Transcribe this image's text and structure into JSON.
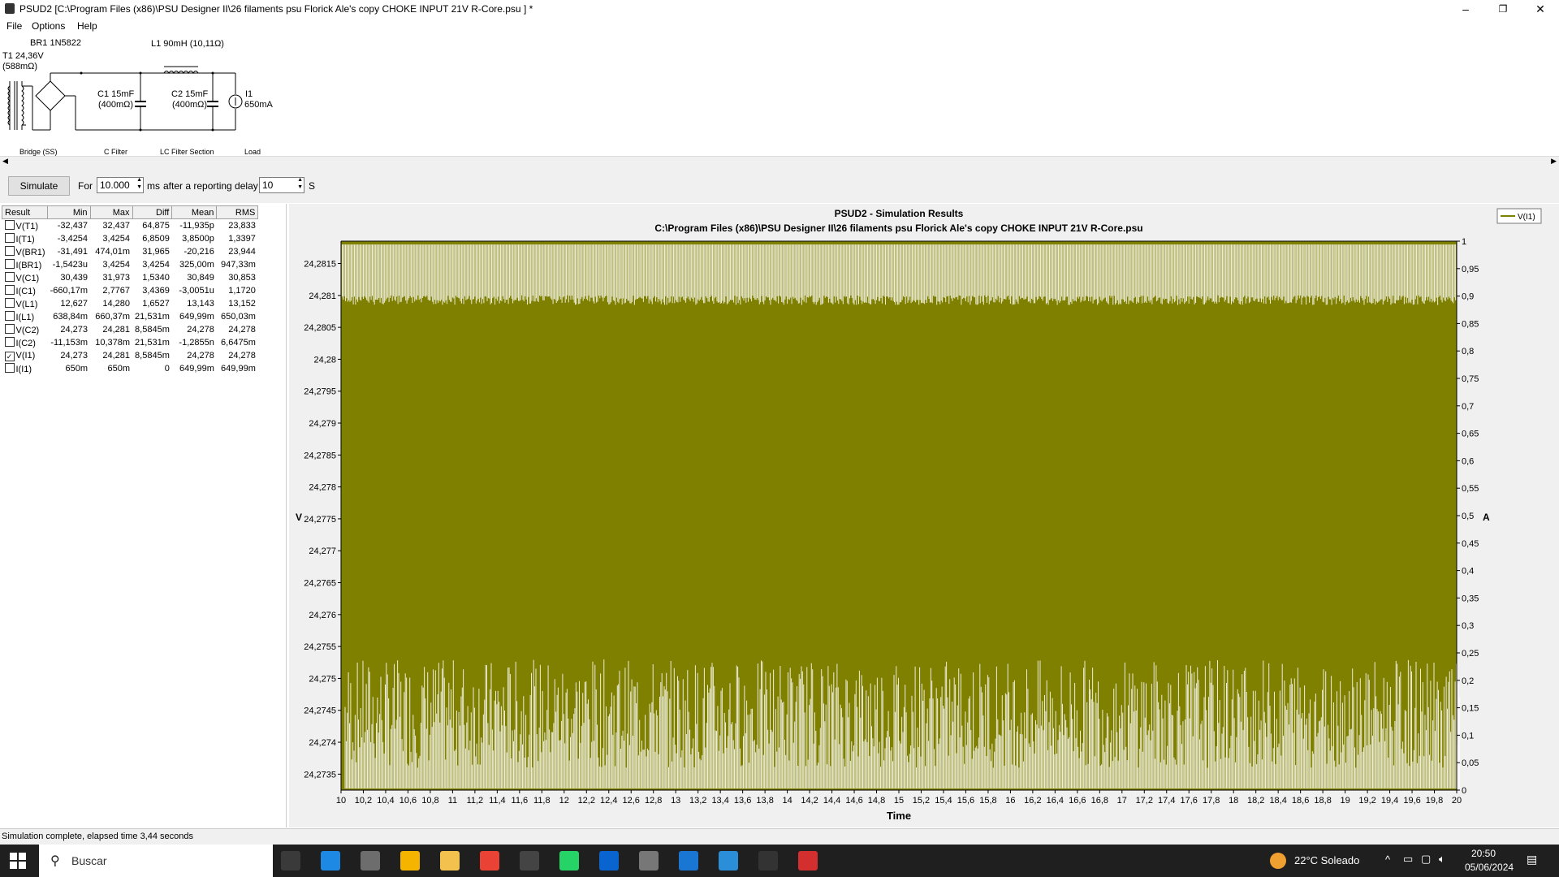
{
  "window": {
    "title": "PSUD2  [C:\\Program Files (x86)\\PSU Designer II\\26 filaments psu Florick Ale's copy CHOKE INPUT 21V R-Core.psu ] *",
    "minimize_glyph": "–",
    "maximize_glyph": "❐",
    "close_glyph": "✕"
  },
  "menu": [
    "File",
    "Options",
    "Help"
  ],
  "schematic": {
    "transformer_label": "T1 24,36V",
    "transformer_res": "(588mΩ)",
    "bridge_label": "BR1 1N5822",
    "choke_label": "L1 90mH (10,11Ω)",
    "c1_label": "C1 15mF",
    "c1_res": "(400mΩ)",
    "c2_label": "C2 15mF",
    "c2_res": "(400mΩ)",
    "load_label": "I1",
    "load_value": "650mA",
    "captions": [
      "Bridge (SS)",
      "C Filter",
      "LC Filter Section",
      "Load"
    ]
  },
  "toolbar": {
    "simulate_label": "Simulate",
    "for_label": "For",
    "duration_value": "10.000",
    "ms_label": "ms",
    "delay_label": "after a reporting delay of",
    "delay_value": "10",
    "s_label": "S"
  },
  "results": {
    "headers": [
      "Result",
      "Min",
      "Max",
      "Diff",
      "Mean",
      "RMS"
    ],
    "rows": [
      {
        "name": "V(T1)",
        "checked": false,
        "min": "-32,437",
        "max": "32,437",
        "diff": "64,875",
        "mean": "-11,935p",
        "rms": "23,833"
      },
      {
        "name": "I(T1)",
        "checked": false,
        "min": "-3,4254",
        "max": "3,4254",
        "diff": "6,8509",
        "mean": "3,8500p",
        "rms": "1,3397"
      },
      {
        "name": "V(BR1)",
        "checked": false,
        "min": "-31,491",
        "max": "474,01m",
        "diff": "31,965",
        "mean": "-20,216",
        "rms": "23,944"
      },
      {
        "name": "I(BR1)",
        "checked": false,
        "min": "-1,5423u",
        "max": "3,4254",
        "diff": "3,4254",
        "mean": "325,00m",
        "rms": "947,33m"
      },
      {
        "name": "V(C1)",
        "checked": false,
        "min": "30,439",
        "max": "31,973",
        "diff": "1,5340",
        "mean": "30,849",
        "rms": "30,853"
      },
      {
        "name": "I(C1)",
        "checked": false,
        "min": "-660,17m",
        "max": "2,7767",
        "diff": "3,4369",
        "mean": "-3,0051u",
        "rms": "1,1720"
      },
      {
        "name": "V(L1)",
        "checked": false,
        "min": "12,627",
        "max": "14,280",
        "diff": "1,6527",
        "mean": "13,143",
        "rms": "13,152"
      },
      {
        "name": "I(L1)",
        "checked": false,
        "min": "638,84m",
        "max": "660,37m",
        "diff": "21,531m",
        "mean": "649,99m",
        "rms": "650,03m"
      },
      {
        "name": "V(C2)",
        "checked": false,
        "min": "24,273",
        "max": "24,281",
        "diff": "8,5845m",
        "mean": "24,278",
        "rms": "24,278"
      },
      {
        "name": "I(C2)",
        "checked": false,
        "min": "-11,153m",
        "max": "10,378m",
        "diff": "21,531m",
        "mean": "-1,2855n",
        "rms": "6,6475m"
      },
      {
        "name": "V(I1)",
        "checked": true,
        "min": "24,273",
        "max": "24,281",
        "diff": "8,5845m",
        "mean": "24,278",
        "rms": "24,278"
      },
      {
        "name": "I(I1)",
        "checked": false,
        "min": "650m",
        "max": "650m",
        "diff": "0",
        "mean": "649,99m",
        "rms": "649,99m"
      }
    ]
  },
  "chart_data": {
    "type": "line",
    "title": "PSUD2 - Simulation Results",
    "subtitle": "C:\\Program Files (x86)\\PSU Designer II\\26 filaments psu Florick Ale's copy CHOKE INPUT 21V R-Core.psu",
    "xlabel": "Time",
    "ylabel_left": "V",
    "ylabel_right": "A",
    "xlim": [
      10,
      20
    ],
    "ylim_left": [
      24.27325,
      24.28185
    ],
    "ylim_right": [
      0,
      1
    ],
    "x_ticks": [
      "10",
      "10,2",
      "10,4",
      "10,6",
      "10,8",
      "11",
      "11,2",
      "11,4",
      "11,6",
      "11,8",
      "12",
      "12,2",
      "12,4",
      "12,6",
      "12,8",
      "13",
      "13,2",
      "13,4",
      "13,6",
      "13,8",
      "14",
      "14,2",
      "14,4",
      "14,6",
      "14,8",
      "15",
      "15,2",
      "15,4",
      "15,6",
      "15,8",
      "16",
      "16,2",
      "16,4",
      "16,6",
      "16,8",
      "17",
      "17,2",
      "17,4",
      "17,6",
      "17,8",
      "18",
      "18,2",
      "18,4",
      "18,6",
      "18,8",
      "19",
      "19,2",
      "19,4",
      "19,6",
      "19,8",
      "20"
    ],
    "y_left_ticks": [
      "24,2815",
      "24,281",
      "24,2805",
      "24,28",
      "24,2795",
      "24,279",
      "24,2785",
      "24,278",
      "24,2775",
      "24,277",
      "24,2765",
      "24,276",
      "24,2755",
      "24,275",
      "24,2745",
      "24,274",
      "24,2735"
    ],
    "y_left_values": [
      24.2815,
      24.281,
      24.2805,
      24.28,
      24.2795,
      24.279,
      24.2785,
      24.278,
      24.2775,
      24.277,
      24.2765,
      24.276,
      24.2755,
      24.275,
      24.2745,
      24.274,
      24.2735
    ],
    "y_right_ticks": [
      "1",
      "0,95",
      "0,9",
      "0,85",
      "0,8",
      "0,75",
      "0,7",
      "0,65",
      "0,6",
      "0,55",
      "0,5",
      "0,45",
      "0,4",
      "0,35",
      "0,3",
      "0,25",
      "0,2",
      "0,15",
      "0,1",
      "0,05",
      "0"
    ],
    "series": [
      {
        "name": "V(I1)",
        "color": "#808000",
        "min": 24.273,
        "max": 24.281,
        "ripple_frequency_hz": 100
      }
    ],
    "legend_position": "top-right",
    "grid": false
  },
  "status": "Simulation complete, elapsed time 3,44 seconds",
  "taskbar": {
    "search_placeholder": "Buscar",
    "weather": "22°C  Soleado",
    "time": "20:50",
    "date": "05/06/2024",
    "apps": [
      "task-view",
      "store",
      "mail",
      "notes",
      "file-explorer",
      "chrome",
      "7zip",
      "whatsapp",
      "outlook",
      "settings",
      "calculator",
      "paint",
      "psud2",
      "acrobat"
    ]
  }
}
